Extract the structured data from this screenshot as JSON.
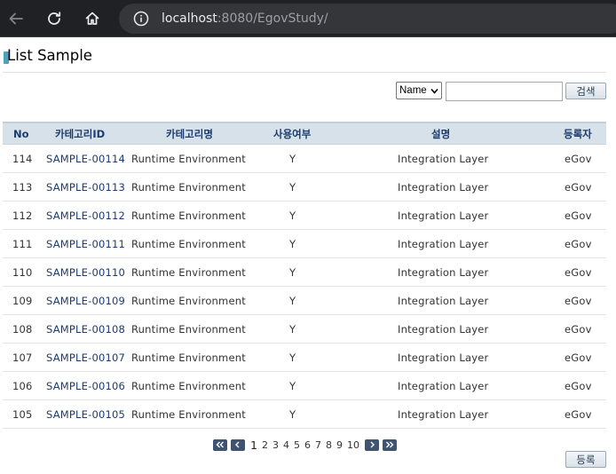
{
  "browser": {
    "url_host": "localhost",
    "url_rest": ":8080/EgovStudy/"
  },
  "page": {
    "title": "List Sample"
  },
  "search": {
    "select_value": "Name",
    "input_value": "",
    "button_label": "검색"
  },
  "table": {
    "headers": [
      "No",
      "카테고리ID",
      "카테고리명",
      "사용여부",
      "설명",
      "등록자"
    ],
    "rows": [
      {
        "no": "114",
        "id": "SAMPLE-00114",
        "name": "Runtime Environment",
        "use": "Y",
        "desc": "Integration Layer",
        "reg": "eGov"
      },
      {
        "no": "113",
        "id": "SAMPLE-00113",
        "name": "Runtime Environment",
        "use": "Y",
        "desc": "Integration Layer",
        "reg": "eGov"
      },
      {
        "no": "112",
        "id": "SAMPLE-00112",
        "name": "Runtime Environment",
        "use": "Y",
        "desc": "Integration Layer",
        "reg": "eGov"
      },
      {
        "no": "111",
        "id": "SAMPLE-00111",
        "name": "Runtime Environment",
        "use": "Y",
        "desc": "Integration Layer",
        "reg": "eGov"
      },
      {
        "no": "110",
        "id": "SAMPLE-00110",
        "name": "Runtime Environment",
        "use": "Y",
        "desc": "Integration Layer",
        "reg": "eGov"
      },
      {
        "no": "109",
        "id": "SAMPLE-00109",
        "name": "Runtime Environment",
        "use": "Y",
        "desc": "Integration Layer",
        "reg": "eGov"
      },
      {
        "no": "108",
        "id": "SAMPLE-00108",
        "name": "Runtime Environment",
        "use": "Y",
        "desc": "Integration Layer",
        "reg": "eGov"
      },
      {
        "no": "107",
        "id": "SAMPLE-00107",
        "name": "Runtime Environment",
        "use": "Y",
        "desc": "Integration Layer",
        "reg": "eGov"
      },
      {
        "no": "106",
        "id": "SAMPLE-00106",
        "name": "Runtime Environment",
        "use": "Y",
        "desc": "Integration Layer",
        "reg": "eGov"
      },
      {
        "no": "105",
        "id": "SAMPLE-00105",
        "name": "Runtime Environment",
        "use": "Y",
        "desc": "Integration Layer",
        "reg": "eGov"
      }
    ]
  },
  "pagination": {
    "current": "1",
    "pages": [
      "2",
      "3",
      "4",
      "5",
      "6",
      "7",
      "8",
      "9",
      "10"
    ]
  },
  "actions": {
    "register_label": "등록"
  }
}
